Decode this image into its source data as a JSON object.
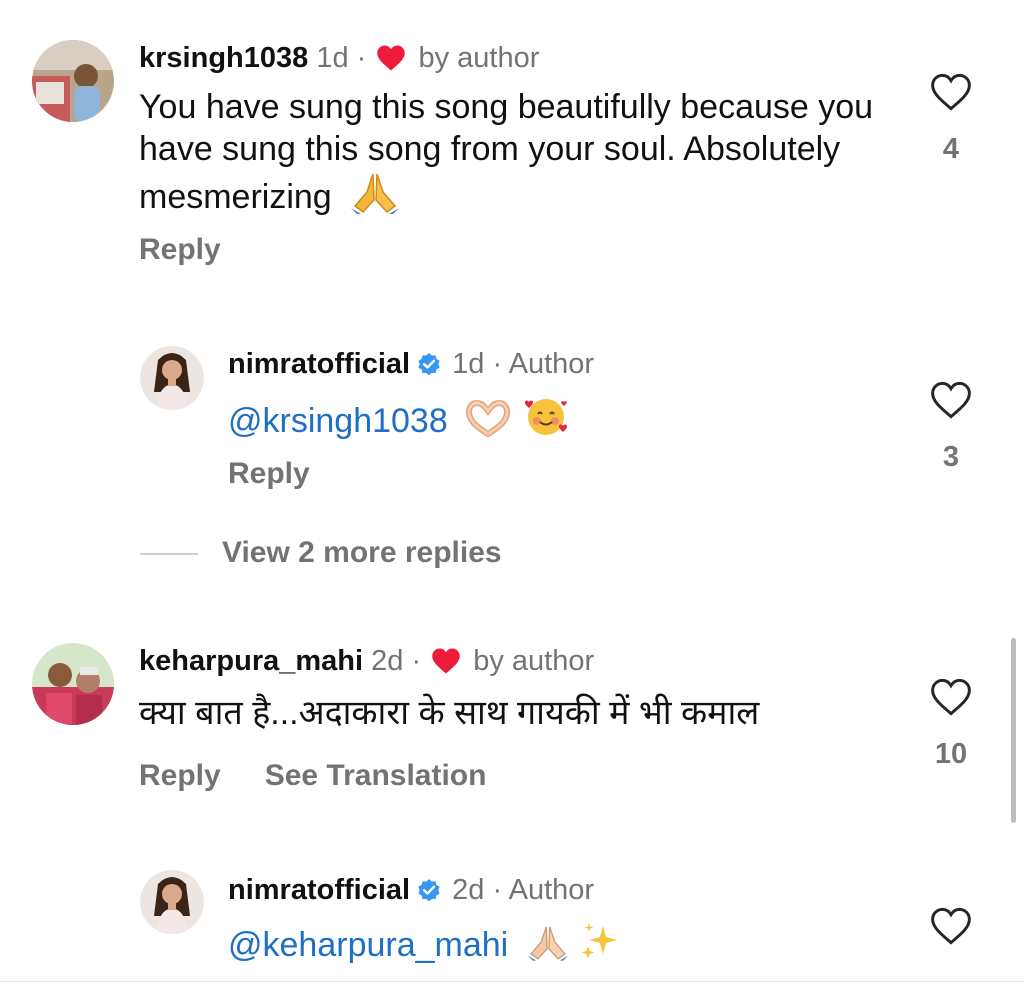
{
  "comments": [
    {
      "username": "krsingh1038",
      "time": "1d",
      "separator": "·",
      "liked_by_author_label": "by author",
      "text": "You have sung this song beautifully because you have sung this song from your soul. Absolutely mesmerizing",
      "emoji": "folded-hands",
      "reply_label": "Reply",
      "like_count": "4",
      "avatar": "user-avatar-krsingh1038"
    },
    {
      "username": "nimratofficial",
      "time": "1d",
      "separator": "·",
      "author_label": "Author",
      "mention": "@krsingh1038",
      "emoji": "heart-hands smiling-face-with-hearts",
      "reply_label": "Reply",
      "like_count": "3",
      "avatar": "user-avatar-nimratofficial"
    },
    {
      "username": "keharpura_mahi",
      "time": "2d",
      "separator": "·",
      "liked_by_author_label": "by author",
      "text": "क्या बात है...अदाकारा के साथ गायकी में भी कमाल",
      "reply_label": "Reply",
      "see_translation_label": "See Translation",
      "like_count": "10",
      "avatar": "user-avatar-keharpura_mahi"
    },
    {
      "username": "nimratofficial",
      "time": "2d",
      "separator": "·",
      "author_label": "Author",
      "mention": "@keharpura_mahi",
      "emoji": "folded-hands sparkles",
      "avatar": "user-avatar-nimratofficial"
    }
  ],
  "view_more_replies_label": "View 2 more replies",
  "colors": {
    "heart_red": "#ed1c3b",
    "verified_blue": "#3897f0",
    "mention_blue": "#1f6fc5",
    "muted_gray": "#737373"
  }
}
